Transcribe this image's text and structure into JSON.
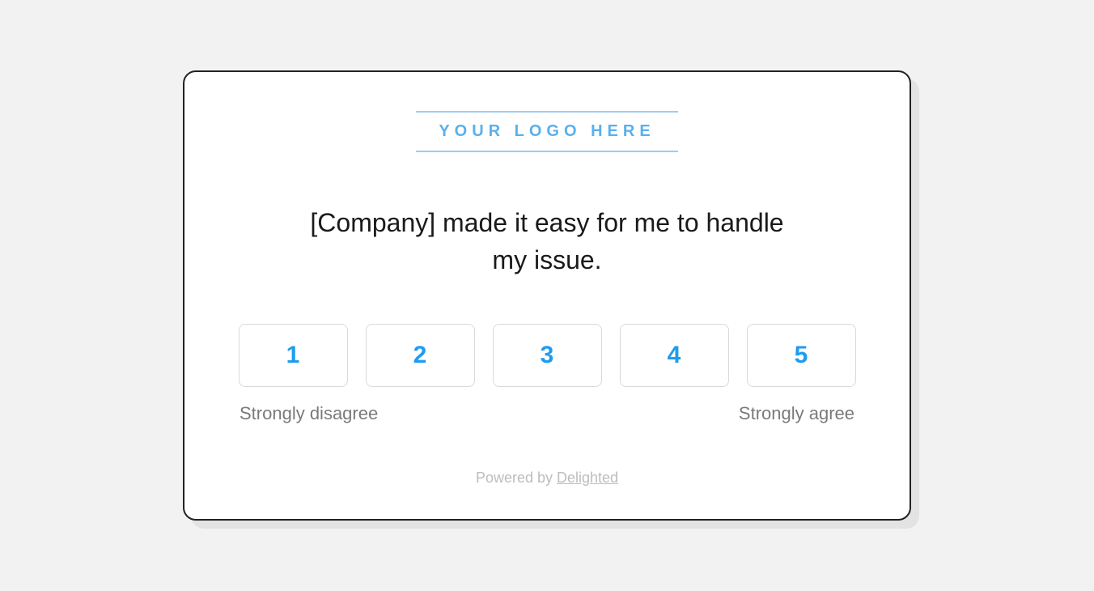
{
  "logo_placeholder": "YOUR LOGO HERE",
  "question": "[Company] made it easy for me to handle my issue.",
  "ratings": {
    "options": [
      "1",
      "2",
      "3",
      "4",
      "5"
    ],
    "low_label": "Strongly disagree",
    "high_label": "Strongly agree"
  },
  "footer": {
    "prefix": "Powered by ",
    "brand": "Delighted"
  }
}
